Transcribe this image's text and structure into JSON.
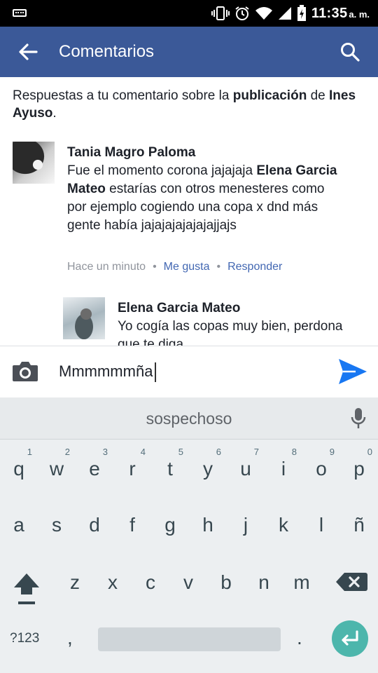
{
  "status_bar": {
    "time": "11:35",
    "ampm": "a. m."
  },
  "app_bar": {
    "title": "Comentarios"
  },
  "intro": {
    "prefix": "Respuestas a tu comentario sobre la ",
    "publication": "publicación",
    "middle": " de ",
    "author": "Ines Ayuso",
    "suffix": "."
  },
  "comments": [
    {
      "name": "Tania Magro Paloma",
      "text_before": "Fue el momento corona jajajaja ",
      "mention": "Elena Garcia Mateo",
      "text_after": " estarías con otros menesteres como por ejemplo cogiendo una copa x dnd más gente había jajajajajajajajjajs",
      "time": "Hace un minuto",
      "like": "Me gusta",
      "reply": "Responder"
    },
    {
      "name": "Elena Garcia Mateo",
      "text": "Yo cogía las copas muy bien, perdona que te diga"
    }
  ],
  "composer": {
    "value": "Mmmmmmña"
  },
  "keyboard": {
    "suggestion": "sospechoso",
    "row1": [
      {
        "ch": "q",
        "num": "1"
      },
      {
        "ch": "w",
        "num": "2"
      },
      {
        "ch": "e",
        "num": "3"
      },
      {
        "ch": "r",
        "num": "4"
      },
      {
        "ch": "t",
        "num": "5"
      },
      {
        "ch": "y",
        "num": "6"
      },
      {
        "ch": "u",
        "num": "7"
      },
      {
        "ch": "i",
        "num": "8"
      },
      {
        "ch": "o",
        "num": "9"
      },
      {
        "ch": "p",
        "num": "0"
      }
    ],
    "row2": [
      "a",
      "s",
      "d",
      "f",
      "g",
      "h",
      "j",
      "k",
      "l",
      "ñ"
    ],
    "row3": [
      "z",
      "x",
      "c",
      "v",
      "b",
      "n",
      "m"
    ],
    "sym": "?123",
    "comma": ",",
    "period": "."
  },
  "colors": {
    "brand": "#3b5998",
    "link": "#4267b2",
    "send": "#1877f2",
    "enter": "#4db6ac"
  }
}
